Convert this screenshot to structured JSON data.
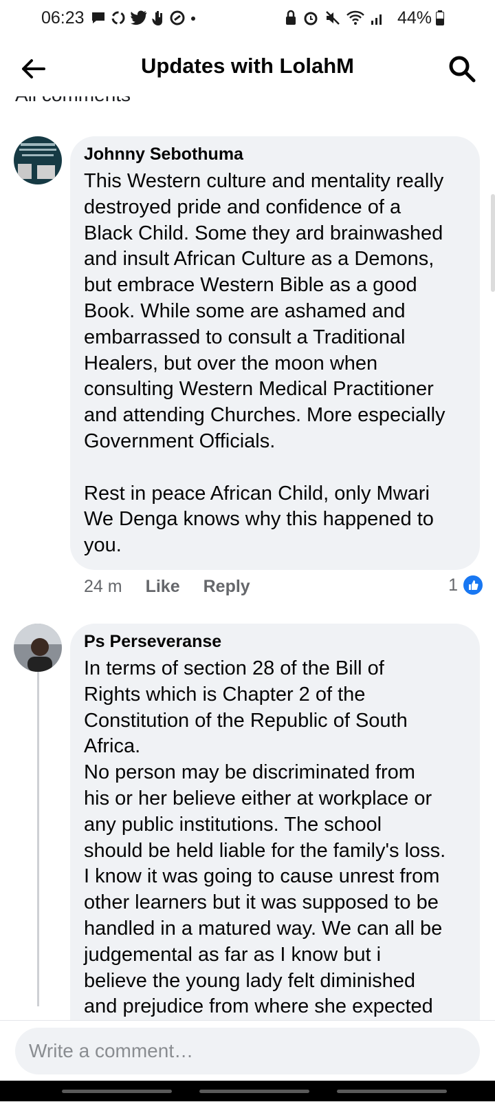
{
  "status": {
    "time": "06:23",
    "battery": "44%",
    "left_icons": [
      "message-icon",
      "sync-icon",
      "twitter-icon",
      "hand-icon",
      "ring-icon",
      "dot-icon"
    ],
    "right_icons": [
      "lock-icon",
      "alarm-icon",
      "mute-icon",
      "wifi-icon",
      "signal-icon"
    ]
  },
  "header": {
    "title": "Updates with LolahM"
  },
  "section": {
    "label": "All comments"
  },
  "comments": [
    {
      "author": "Johnny Sebothuma",
      "text": "This Western culture and mentality really\ndestroyed pride and confidence of a\nBlack Child. Some they ard brainwashed\nand insult African Culture as a Demons,\nbut embrace Western Bible as a good\nBook. While some are ashamed and\nembarrassed to consult a Traditional\nHealers, but over the moon when\nconsulting Western Medical Practitioner\nand attending Churches. More especially\nGovernment Officials.\n\nRest in peace African Child, only Mwari\nWe Denga knows why this happened to\nyou.",
      "time": "24 m",
      "like_label": "Like",
      "reply_label": "Reply",
      "reaction_count": "1"
    },
    {
      "author": "Ps Perseveranse",
      "text": "In terms of section 28 of the Bill of\nRights which is Chapter 2 of the\nConstitution of the Republic of South\nAfrica.\nNo person may be discriminated from\nhis or her believe either at workplace or\nany public institutions. The school\nshould be held liable for the family's loss.\nI know it was going to cause unrest from\nother learners but it was supposed to be\nhandled in a matured way. We can all be\njudgemental as far as I know but i\nbelieve the young lady felt diminished\nand prejudice from where she expected"
    }
  ],
  "composer": {
    "placeholder": "Write a comment…"
  },
  "colors": {
    "bubble": "#f0f2f5",
    "secondary_text": "#65676b",
    "like_blue": "#1877f2"
  }
}
